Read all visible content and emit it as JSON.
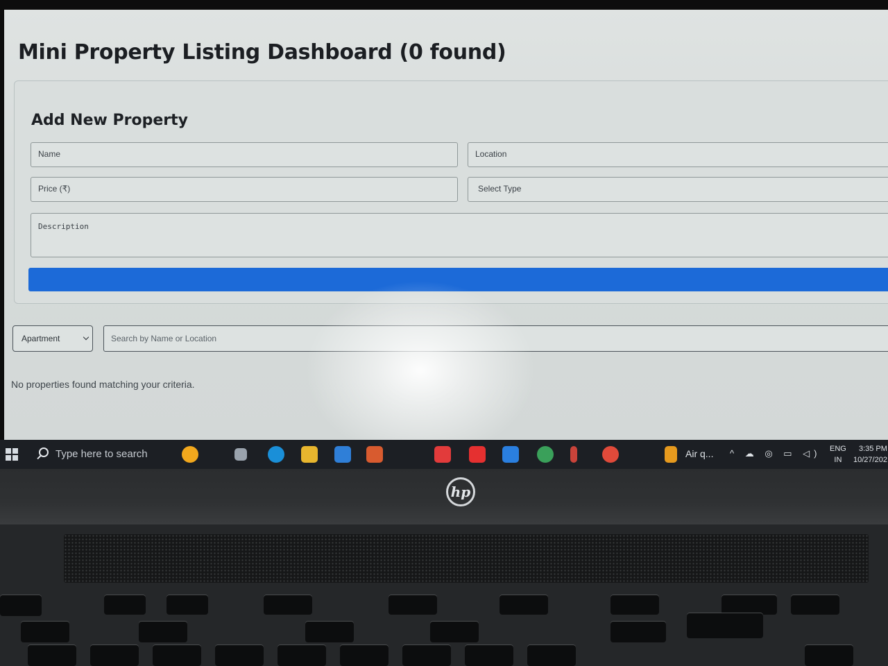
{
  "app": {
    "title": "Mini Property Listing Dashboard (0 found)"
  },
  "form": {
    "title": "Add New Property",
    "name_placeholder": "Name",
    "location_placeholder": "Location",
    "price_placeholder": "Price (₹)",
    "type_placeholder": "Select Type",
    "description_placeholder": "Description",
    "submit_color": "#1c6ad8"
  },
  "filters": {
    "type_value": "Apartment",
    "search_placeholder": "Search by Name or Location"
  },
  "results": {
    "empty_message": "No properties found matching your criteria."
  },
  "taskbar": {
    "search_placeholder": "Type here to search",
    "weather": "Air q...",
    "language_line1": "ENG",
    "language_line2": "IN",
    "time": "3:35 PM",
    "date": "10/27/202"
  },
  "laptop": {
    "brand": "hp"
  }
}
